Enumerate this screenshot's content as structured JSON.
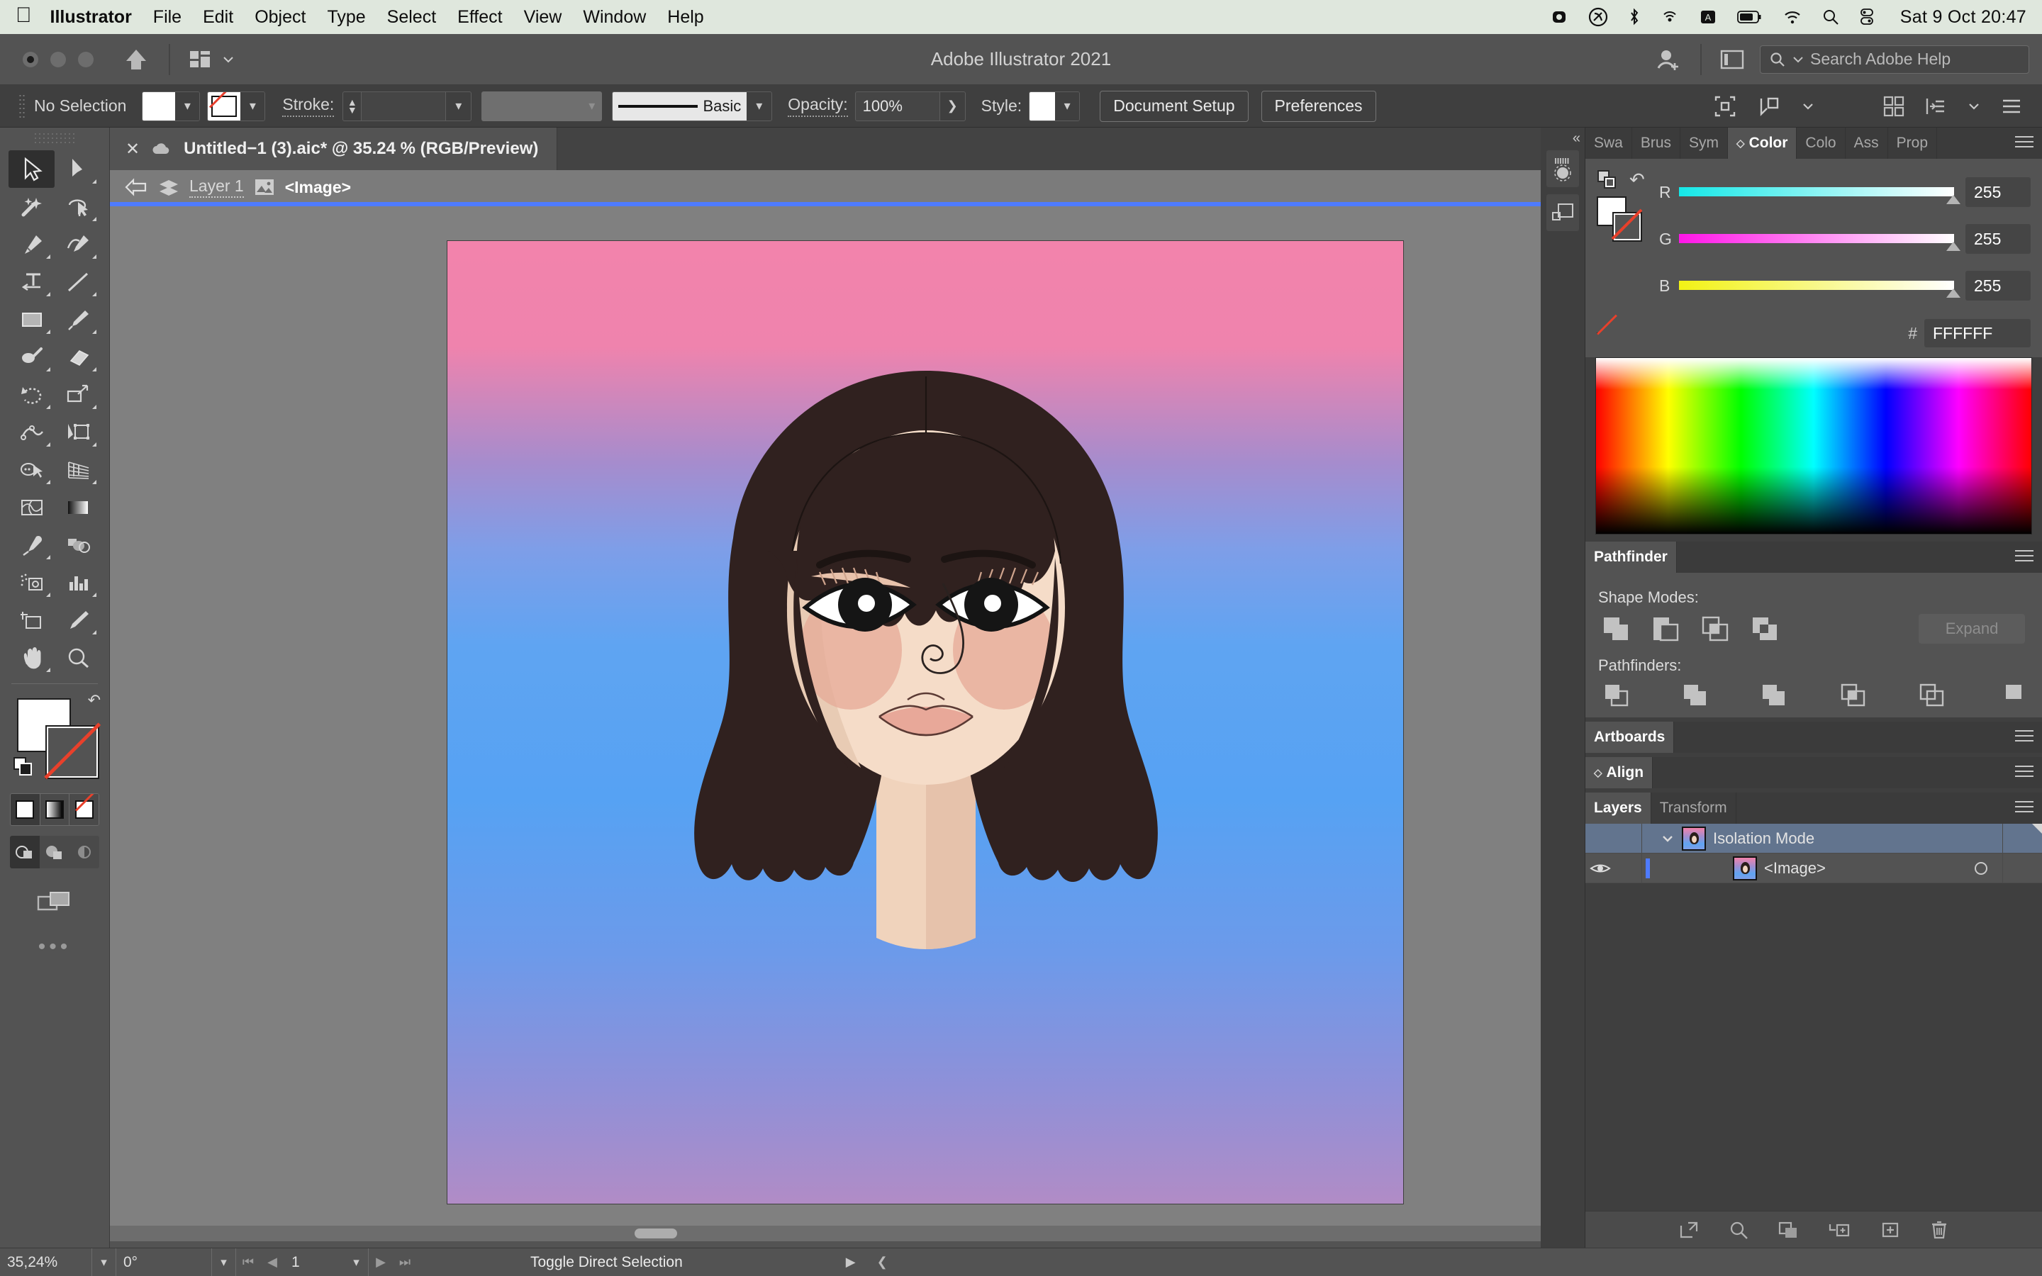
{
  "macos": {
    "apple_icon": "apple-logo",
    "menus": [
      "Illustrator",
      "File",
      "Edit",
      "Object",
      "Type",
      "Select",
      "Effect",
      "View",
      "Window",
      "Help"
    ],
    "status_icons": [
      "screen-record-icon",
      "creative-cloud-icon",
      "bluetooth-icon",
      "airplay-icon",
      "keyboard-input-icon",
      "battery-icon",
      "wifi-icon",
      "spotlight-search-icon",
      "control-center-icon"
    ],
    "clock": "Sat 9 Oct  20:47"
  },
  "titlebar": {
    "app_title": "Adobe Illustrator 2021",
    "home_icon": "home-icon",
    "arrange_icon": "arrange-documents-icon",
    "account_icon": "account-add-icon",
    "workspace_icon": "workspace-switcher-icon",
    "search_icon": "search-icon",
    "search_placeholder": "Search Adobe Help"
  },
  "controlbar": {
    "selection_state": "No Selection",
    "fill_color": "#FFFFFF",
    "stroke_color": "none",
    "stroke_label": "Stroke:",
    "stroke_weight": "",
    "variable_width_profile": "",
    "brush_definition": "Basic",
    "opacity_label": "Opacity:",
    "opacity_value": "100%",
    "style_label": "Style:",
    "document_setup": "Document Setup",
    "preferences": "Preferences",
    "right_icons": [
      "select-similar-icon",
      "align-icon",
      "chevron-down-icon",
      "grid-view-icon",
      "snap-icon",
      "panel-menu-icon"
    ]
  },
  "document_tab": {
    "close_icon": "close-icon",
    "cloud_icon": "cloud-document-icon",
    "title": "Untitled−1 (3).aic* @ 35.24 % (RGB/Preview)"
  },
  "breadcrumb": {
    "back_icon": "back-arrow-icon",
    "layer_icon": "layers-icon",
    "layer_name": "Layer 1",
    "image_icon": "image-icon",
    "object_name": "<Image>",
    "isolation_bar_color": "#4E7BFF"
  },
  "toolbar": {
    "tools": [
      {
        "name": "selection-tool",
        "active": true
      },
      {
        "name": "direct-selection-tool",
        "active": false
      },
      {
        "name": "magic-wand-tool",
        "active": false
      },
      {
        "name": "lasso-tool",
        "active": false
      },
      {
        "name": "pen-tool",
        "active": false
      },
      {
        "name": "curvature-tool",
        "active": false
      },
      {
        "name": "type-tool",
        "active": false
      },
      {
        "name": "line-segment-tool",
        "active": false
      },
      {
        "name": "rectangle-tool",
        "active": false
      },
      {
        "name": "paintbrush-tool",
        "active": false
      },
      {
        "name": "shaper-tool",
        "active": false
      },
      {
        "name": "eraser-tool",
        "active": false
      },
      {
        "name": "rotate-tool",
        "active": false
      },
      {
        "name": "scale-tool",
        "active": false
      },
      {
        "name": "width-tool",
        "active": false
      },
      {
        "name": "free-transform-tool",
        "active": false
      },
      {
        "name": "shape-builder-tool",
        "active": false
      },
      {
        "name": "perspective-grid-tool",
        "active": false
      },
      {
        "name": "mesh-tool",
        "active": false
      },
      {
        "name": "gradient-tool",
        "active": false
      },
      {
        "name": "eyedropper-tool",
        "active": false
      },
      {
        "name": "blend-tool",
        "active": false
      },
      {
        "name": "symbol-sprayer-tool",
        "active": false
      },
      {
        "name": "column-graph-tool",
        "active": false
      },
      {
        "name": "artboard-tool",
        "active": false
      },
      {
        "name": "slice-tool",
        "active": false
      },
      {
        "name": "hand-tool",
        "active": false
      },
      {
        "name": "zoom-tool",
        "active": false
      }
    ],
    "fill_color": "#FFFFFF",
    "stroke_color": "none",
    "swap_icon": "swap-fill-stroke-icon",
    "default_icon": "default-fill-stroke-icon",
    "color_modes": [
      "color-swatch-icon",
      "gradient-icon",
      "none-icon"
    ],
    "draw_modes": [
      "draw-normal-icon",
      "draw-behind-icon",
      "draw-inside-icon"
    ],
    "screen_mode_icon": "change-screen-mode-icon",
    "more_tools_icon": "edit-toolbar-icon"
  },
  "canvas": {
    "artboard_gradient_top": "#F283AC",
    "artboard_gradient_mid": "#5FA4F2",
    "artboard_gradient_bottom": "#B18CC6",
    "artwork": "woman-portrait-illustration",
    "hair_color": "#2F2220",
    "skin_color": "#F2DCC9",
    "blush_color": "#E3A995",
    "lips_color": "#E3A898"
  },
  "dock": {
    "collapse_icon": "collapse-panels-icon",
    "buttons": [
      "color-themes-icon",
      "libraries-icon"
    ]
  },
  "panels": {
    "color_group": {
      "tabs": [
        "Swa",
        "Brus",
        "Sym",
        "Color",
        "Colo",
        "Ass",
        "Prop"
      ],
      "active_tab": "Color",
      "menu_icon": "panel-menu-icon",
      "fill_stroke_icon": "fill-stroke-proxy-icon",
      "swap_icon": "swap-colors-icon",
      "sliders": [
        {
          "label": "R",
          "value": "255",
          "bar_from": "#15E8E8",
          "bar_to": "#FFFFFF"
        },
        {
          "label": "G",
          "value": "255",
          "bar_from": "#FF15E8",
          "bar_to": "#FFFFFF"
        },
        {
          "label": "B",
          "value": "255",
          "bar_from": "#F2F215",
          "bar_to": "#FFFFFF"
        }
      ],
      "hash_label": "#",
      "hex_value": "FFFFFF",
      "quick_swatches": [
        "none",
        "#000000",
        "#FFFFFF"
      ]
    },
    "pathfinder": {
      "tab": "Pathfinder",
      "menu_icon": "panel-menu-icon",
      "shape_modes_label": "Shape Modes:",
      "shape_mode_icons": [
        "unite-icon",
        "minus-front-icon",
        "intersect-icon",
        "exclude-icon"
      ],
      "expand_label": "Expand",
      "pathfinders_label": "Pathfinders:",
      "pathfinder_icons": [
        "divide-icon",
        "trim-icon",
        "merge-icon",
        "crop-icon",
        "outline-icon",
        "minus-back-icon"
      ]
    },
    "artboards": {
      "tab": "Artboards",
      "menu_icon": "panel-menu-icon"
    },
    "align": {
      "tab": "Align",
      "menu_icon": "panel-menu-icon"
    },
    "layers": {
      "tabs": [
        "Layers",
        "Transform"
      ],
      "active_tab": "Layers",
      "menu_icon": "panel-menu-icon",
      "rows": [
        {
          "name": "Isolation Mode",
          "selected": true,
          "expanded": true,
          "eye": false,
          "target": false
        },
        {
          "name": "<Image>",
          "selected": false,
          "expanded": false,
          "eye": true,
          "target": true
        }
      ],
      "footer_icons": [
        "release-to-layers-icon",
        "locate-object-icon",
        "make-clipping-mask-icon",
        "create-sublayer-icon",
        "create-new-layer-icon",
        "delete-selection-icon"
      ]
    }
  },
  "statusbar": {
    "zoom_value": "35,24%",
    "rotate_value": "0°",
    "artboard_number": "1",
    "first_icon": "first-artboard-icon",
    "prev_icon": "previous-artboard-icon",
    "next_icon": "next-artboard-icon",
    "last_icon": "last-artboard-icon",
    "status_text": "Toggle Direct Selection",
    "play_icon": "play-icon",
    "resize_icon": "resize-handle-icon"
  }
}
